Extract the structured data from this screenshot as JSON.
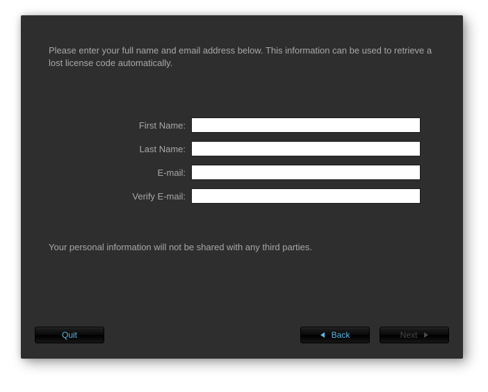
{
  "instructions": "Please enter your full name and email address below. This information can be used to retrieve a lost license code automatically.",
  "form": {
    "first_name": {
      "label": "First Name:",
      "value": ""
    },
    "last_name": {
      "label": "Last Name:",
      "value": ""
    },
    "email": {
      "label": "E-mail:",
      "value": ""
    },
    "verify_email": {
      "label": "Verify E-mail:",
      "value": ""
    }
  },
  "privacy_note": "Your personal information will not be shared with any third parties.",
  "buttons": {
    "quit": "Quit",
    "back": "Back",
    "next": "Next"
  },
  "colors": {
    "panel_bg": "#2e2e2e",
    "text_muted": "#a8a8a8",
    "accent": "#5fb7e6",
    "disabled": "#4a4a4a"
  }
}
